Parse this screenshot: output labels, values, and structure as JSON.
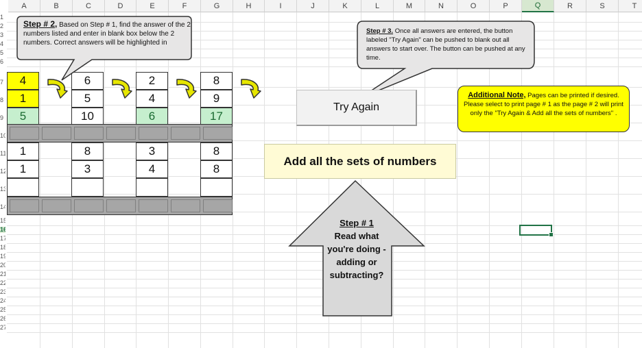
{
  "columns": [
    "A",
    "B",
    "C",
    "D",
    "E",
    "F",
    "G",
    "H",
    "I",
    "J",
    "K",
    "L",
    "M",
    "N",
    "O",
    "P",
    "Q",
    "R",
    "S",
    "T"
  ],
  "selected_column": "Q",
  "rows": [
    "1",
    "2",
    "3",
    "4",
    "5",
    "6",
    "7",
    "8",
    "9",
    "10",
    "11",
    "12",
    "13",
    "14",
    "15",
    "16",
    "17",
    "18",
    "19",
    "20",
    "21",
    "22",
    "23",
    "24",
    "25",
    "26",
    "27"
  ],
  "selected_row": "16",
  "problems": [
    {
      "top": "4",
      "bottom": "1",
      "answer": "5",
      "top_highlighted": true,
      "bottom_highlighted": true,
      "answer_correct": true
    },
    {
      "top": "6",
      "bottom": "5",
      "answer": "10",
      "top_highlighted": false,
      "bottom_highlighted": false,
      "answer_correct": false
    },
    {
      "top": "2",
      "bottom": "4",
      "answer": "6",
      "top_highlighted": false,
      "bottom_highlighted": false,
      "answer_correct": true
    },
    {
      "top": "8",
      "bottom": "9",
      "answer": "17",
      "top_highlighted": false,
      "bottom_highlighted": false,
      "answer_correct": true
    }
  ],
  "problems_set2": [
    {
      "top": "1",
      "bottom": "1",
      "answer": ""
    },
    {
      "top": "8",
      "bottom": "3",
      "answer": ""
    },
    {
      "top": "3",
      "bottom": "4",
      "answer": ""
    },
    {
      "top": "8",
      "bottom": "8",
      "answer": ""
    }
  ],
  "step2": {
    "title": "Step # 2,",
    "text": " Based on Step # 1, find the answer of the 2 numbers listed and enter in blank box below the 2 numbers.  Correct answers will be highlighted in"
  },
  "step3": {
    "title": "Step # 3.",
    "text": "  Once all answers are entered, the button labeled \"Try Again\" can be pushed to blank out all answers to start over.  The button can be pushed at any time."
  },
  "try_again_label": "Try Again",
  "add_label": "Add all the sets of numbers",
  "note": {
    "title": "Additional Note,",
    "text": "  Pages can be printed if desired. Please select to print page # 1 as the page # 2 will print only the \"Try Again & Add all the sets of numbers\" ."
  },
  "step1": {
    "title": "Step # 1",
    "line1": "Read what",
    "line2": "you're doing -",
    "line3": "adding or",
    "line4": "subtracting?"
  },
  "colors": {
    "highlight": "#ffff00",
    "correct_fill": "#c6efce",
    "correct_text": "#1a6b31",
    "excel_green": "#217346",
    "arrow_fill": "#e6e600"
  },
  "icons": [
    "curved-arrow-icon"
  ]
}
